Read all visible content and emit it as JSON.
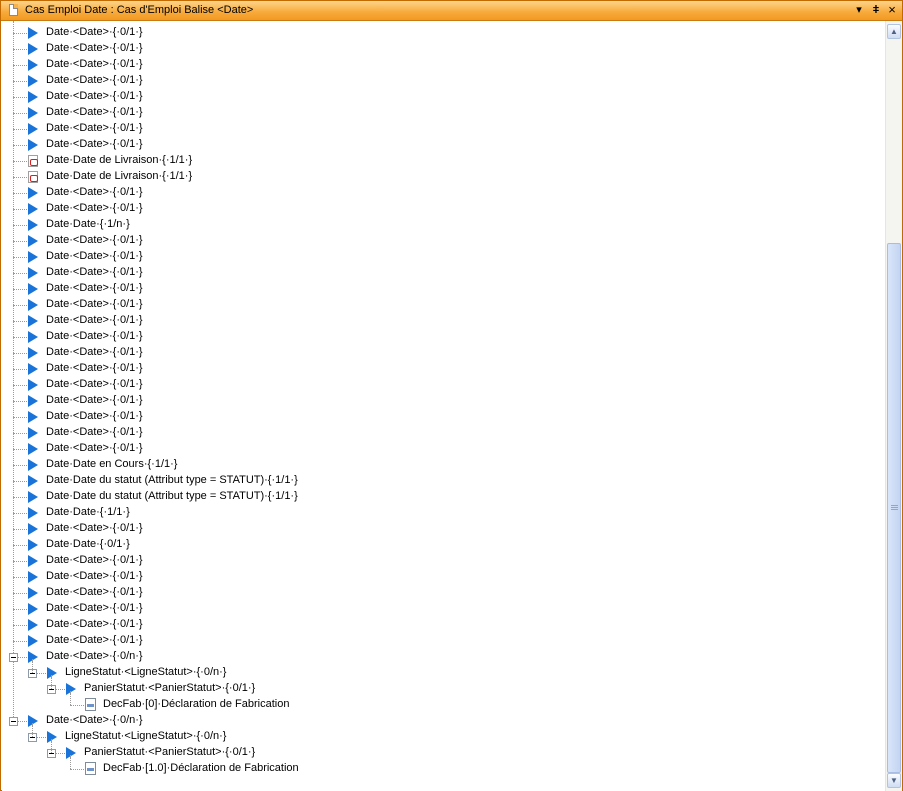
{
  "window": {
    "title": "Cas Emploi  Date : Cas d'Emploi Balise <Date>",
    "dropdown_glyph": "▾",
    "pin_glyph": "ǂ",
    "close_glyph": "×"
  },
  "tree": {
    "items": [
      {
        "label": "Date·<Date>·{·0/1·}",
        "icon": "blue-triangle",
        "level": 0
      },
      {
        "label": "Date·<Date>·{·0/1·}",
        "icon": "blue-triangle",
        "level": 0
      },
      {
        "label": "Date·<Date>·{·0/1·}",
        "icon": "blue-triangle",
        "level": 0
      },
      {
        "label": "Date·<Date>·{·0/1·}",
        "icon": "blue-triangle",
        "level": 0
      },
      {
        "label": "Date·<Date>·{·0/1·}",
        "icon": "blue-triangle",
        "level": 0
      },
      {
        "label": "Date·<Date>·{·0/1·}",
        "icon": "blue-triangle",
        "level": 0
      },
      {
        "label": "Date·<Date>·{·0/1·}",
        "icon": "blue-triangle",
        "level": 0
      },
      {
        "label": "Date·<Date>·{·0/1·}",
        "icon": "blue-triangle",
        "level": 0
      },
      {
        "label": "Date·Date de Livraison·{·1/1·}",
        "icon": "pdf",
        "level": 0
      },
      {
        "label": "Date·Date de Livraison·{·1/1·}",
        "icon": "pdf",
        "level": 0
      },
      {
        "label": "Date·<Date>·{·0/1·}",
        "icon": "blue-triangle",
        "level": 0
      },
      {
        "label": "Date·<Date>·{·0/1·}",
        "icon": "blue-triangle",
        "level": 0
      },
      {
        "label": "Date·Date·{·1/n·}",
        "icon": "blue-triangle",
        "level": 0
      },
      {
        "label": "Date·<Date>·{·0/1·}",
        "icon": "blue-triangle",
        "level": 0
      },
      {
        "label": "Date·<Date>·{·0/1·}",
        "icon": "blue-triangle",
        "level": 0
      },
      {
        "label": "Date·<Date>·{·0/1·}",
        "icon": "blue-triangle",
        "level": 0
      },
      {
        "label": "Date·<Date>·{·0/1·}",
        "icon": "blue-triangle",
        "level": 0
      },
      {
        "label": "Date·<Date>·{·0/1·}",
        "icon": "blue-triangle",
        "level": 0
      },
      {
        "label": "Date·<Date>·{·0/1·}",
        "icon": "blue-triangle",
        "level": 0
      },
      {
        "label": "Date·<Date>·{·0/1·}",
        "icon": "blue-triangle",
        "level": 0
      },
      {
        "label": "Date·<Date>·{·0/1·}",
        "icon": "blue-triangle",
        "level": 0
      },
      {
        "label": "Date·<Date>·{·0/1·}",
        "icon": "blue-triangle",
        "level": 0
      },
      {
        "label": "Date·<Date>·{·0/1·}",
        "icon": "blue-triangle",
        "level": 0
      },
      {
        "label": "Date·<Date>·{·0/1·}",
        "icon": "blue-triangle",
        "level": 0
      },
      {
        "label": "Date·<Date>·{·0/1·}",
        "icon": "blue-triangle",
        "level": 0
      },
      {
        "label": "Date·<Date>·{·0/1·}",
        "icon": "blue-triangle",
        "level": 0
      },
      {
        "label": "Date·<Date>·{·0/1·}",
        "icon": "blue-triangle",
        "level": 0
      },
      {
        "label": "Date·Date en Cours·{·1/1·}",
        "icon": "blue-triangle",
        "level": 0
      },
      {
        "label": "Date·Date du statut (Attribut type = STATUT)·{·1/1·}",
        "icon": "blue-triangle",
        "level": 0
      },
      {
        "label": "Date·Date du statut (Attribut type = STATUT)·{·1/1·}",
        "icon": "blue-triangle",
        "level": 0
      },
      {
        "label": "Date·Date·{·1/1·}",
        "icon": "blue-triangle",
        "level": 0
      },
      {
        "label": "Date·<Date>·{·0/1·}",
        "icon": "blue-triangle",
        "level": 0
      },
      {
        "label": "Date·Date·{·0/1·}",
        "icon": "blue-triangle",
        "level": 0
      },
      {
        "label": "Date·<Date>·{·0/1·}",
        "icon": "blue-triangle",
        "level": 0
      },
      {
        "label": "Date·<Date>·{·0/1·}",
        "icon": "blue-triangle",
        "level": 0
      },
      {
        "label": "Date·<Date>·{·0/1·}",
        "icon": "blue-triangle",
        "level": 0
      },
      {
        "label": "Date·<Date>·{·0/1·}",
        "icon": "blue-triangle",
        "level": 0
      },
      {
        "label": "Date·<Date>·{·0/1·}",
        "icon": "blue-triangle",
        "level": 0
      },
      {
        "label": "Date·<Date>·{·0/1·}",
        "icon": "blue-triangle",
        "level": 0
      },
      {
        "label": "Date·<Date>·{·0/n·}",
        "icon": "blue-triangle",
        "level": 0,
        "expanded": true
      },
      {
        "label": "LigneStatut·<LigneStatut>·{·0/n·}",
        "icon": "blue-triangle",
        "level": 1,
        "expanded": true
      },
      {
        "label": "PanierStatut·<PanierStatut>·{·0/1·}",
        "icon": "blue-triangle",
        "level": 2,
        "expanded": true
      },
      {
        "label": "DecFab·[0]·Déclaration de Fabrication",
        "icon": "document",
        "level": 3
      },
      {
        "label": "Date·<Date>·{·0/n·}",
        "icon": "blue-triangle",
        "level": 0,
        "expanded": true
      },
      {
        "label": "LigneStatut·<LigneStatut>·{·0/n·}",
        "icon": "blue-triangle",
        "level": 1,
        "expanded": true
      },
      {
        "label": "PanierStatut·<PanierStatut>·{·0/1·}",
        "icon": "blue-triangle",
        "level": 2,
        "expanded": true
      },
      {
        "label": "DecFab·[1.0]·Déclaration de Fabrication",
        "icon": "document",
        "level": 3
      }
    ]
  },
  "scrollbar": {
    "up_glyph": "▲",
    "down_glyph": "▼",
    "scroll_fraction": 0.95
  }
}
